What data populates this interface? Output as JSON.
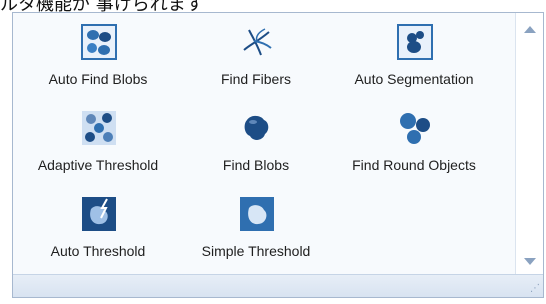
{
  "caption": "ルタ機能が 事けられます",
  "colors": {
    "border": "#a7b8cf",
    "icon_blue": "#2f6fb0",
    "icon_dark": "#1d4d86"
  },
  "items": [
    {
      "label": "Auto Find Blobs",
      "icon": "auto-find-blobs-icon"
    },
    {
      "label": "Find Fibers",
      "icon": "find-fibers-icon"
    },
    {
      "label": "Auto Segmentation",
      "icon": "auto-segmentation-icon"
    },
    {
      "label": "Adaptive Threshold",
      "icon": "adaptive-threshold-icon"
    },
    {
      "label": "Find Blobs",
      "icon": "find-blobs-icon"
    },
    {
      "label": "Find Round Objects",
      "icon": "find-round-objects-icon"
    },
    {
      "label": "Auto Threshold",
      "icon": "auto-threshold-icon"
    },
    {
      "label": "Simple Threshold",
      "icon": "simple-threshold-icon"
    }
  ]
}
